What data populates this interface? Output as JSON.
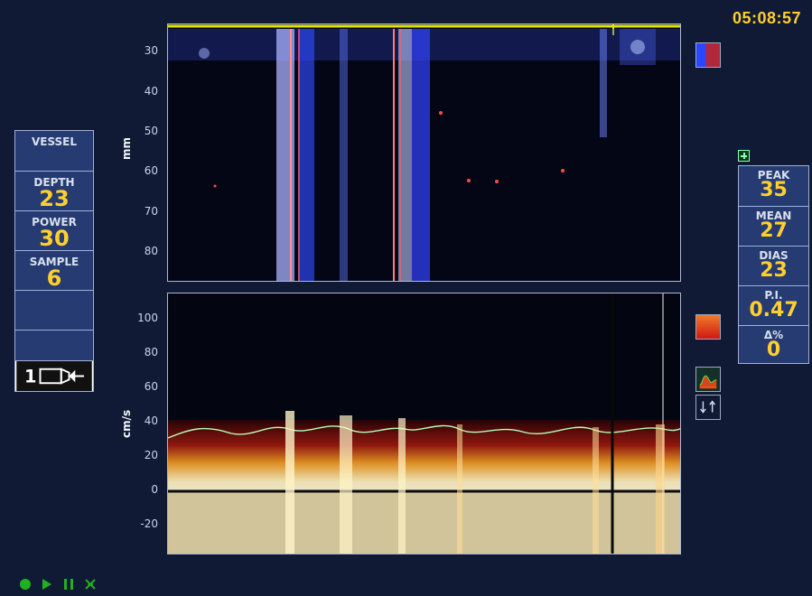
{
  "clock": "05:08:57",
  "left_panel": {
    "vessel_label": "VESSEL",
    "depth_label": "DEPTH",
    "depth_value": "23",
    "power_label": "POWER",
    "power_value": "30",
    "sample_label": "SAMPLE",
    "sample_value": "6",
    "probe_number": "1"
  },
  "right_panel": {
    "peak_label": "PEAK",
    "peak_value": "35",
    "mean_label": "MEAN",
    "mean_value": "27",
    "dias_label": "DIAS",
    "dias_value": "23",
    "pi_label": "P.I.",
    "pi_value": "0.47",
    "delta_label": "Δ%",
    "delta_value": "0"
  },
  "top_plot": {
    "y_title": "mm",
    "ticks": [
      "30",
      "40",
      "50",
      "60",
      "70",
      "80"
    ]
  },
  "bottom_plot": {
    "y_title": "cm/s",
    "ticks": [
      "100",
      "80",
      "60",
      "40",
      "20",
      "0",
      "-20"
    ]
  },
  "colors": {
    "accent": "#ffcf2f",
    "panel": "#253b71",
    "background": "#101a34"
  },
  "icons": {
    "play": "play-icon",
    "pause": "pause-icon",
    "record": "record-icon",
    "tool": "waveform-icon",
    "arrow": "scroll-arrows-icon"
  }
}
